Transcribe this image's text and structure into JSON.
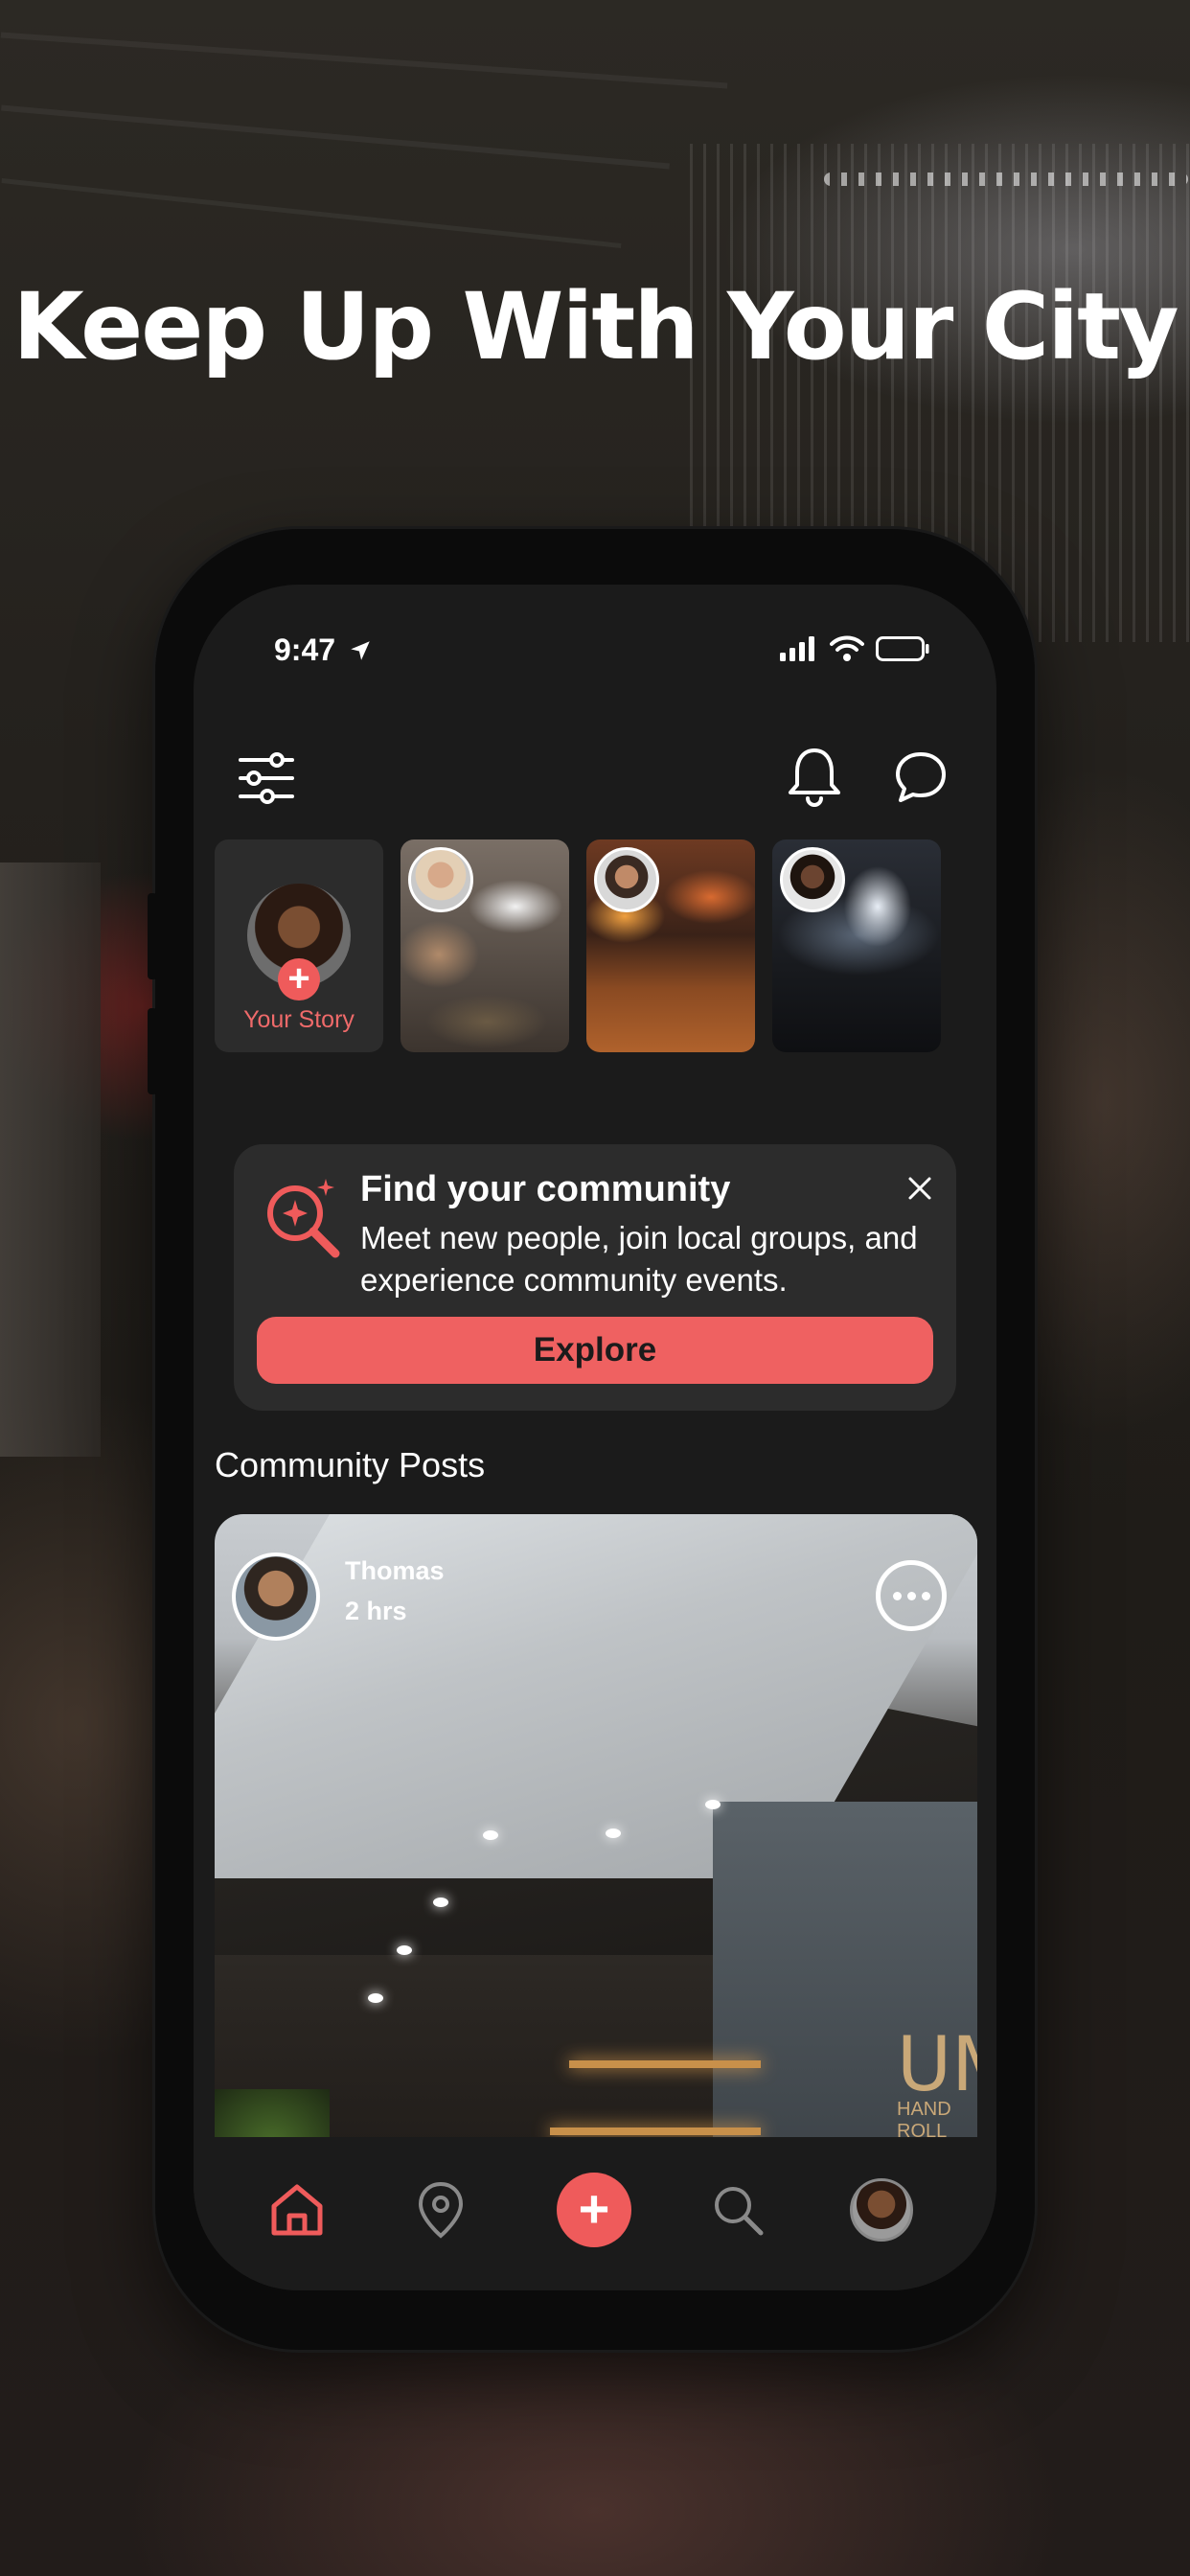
{
  "headline": "Keep Up With Your City",
  "status_bar": {
    "time": "9:47"
  },
  "top_bar": {
    "filter_icon": "sliders-icon",
    "notification_icon": "bell-icon",
    "chat_icon": "chat-bubble-icon"
  },
  "stories": {
    "your_story_label": "Your Story",
    "items": [
      {
        "scene": "restaurant dining table"
      },
      {
        "scene": "bar interior"
      },
      {
        "scene": "concert crowd"
      }
    ]
  },
  "community_card": {
    "title": "Find your community",
    "description": "Meet new people, join local  groups, and experience community events.",
    "button_label": "Explore",
    "icon": "search-sparkle-icon"
  },
  "feed": {
    "section_title": "Community Posts",
    "posts": [
      {
        "author": "Thomas",
        "time": "2 hrs",
        "brand_text": "UM",
        "brand_subtext": "HAND ROLL"
      }
    ]
  },
  "bottom_nav": {
    "items": [
      "home-icon",
      "location-pin-icon",
      "add-icon",
      "search-icon",
      "profile-avatar"
    ]
  },
  "colors": {
    "accent": "#EF5B5B",
    "background": "#1B1B1B",
    "card": "#2C2C2C"
  }
}
